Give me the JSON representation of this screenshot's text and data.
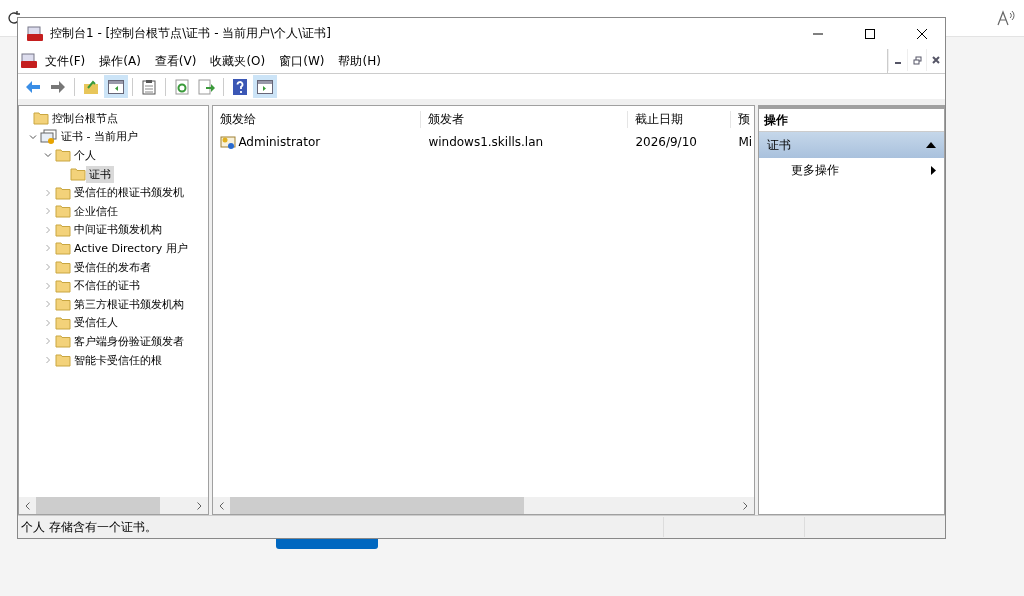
{
  "window": {
    "title": "控制台1 - [控制台根节点\\证书 - 当前用户\\个人\\证书]"
  },
  "menu": [
    "文件(F)",
    "操作(A)",
    "查看(V)",
    "收藏夹(O)",
    "窗口(W)",
    "帮助(H)"
  ],
  "toolbar": [
    {
      "kind": "back",
      "on": false
    },
    {
      "kind": "forward",
      "on": false
    },
    {
      "kind": "up",
      "on": false
    },
    {
      "kind": "tree",
      "on": true
    },
    {
      "kind": "properties",
      "on": false
    },
    {
      "kind": "refresh",
      "on": false
    },
    {
      "kind": "export",
      "on": false
    },
    {
      "kind": "help",
      "on": false
    },
    {
      "kind": "actions",
      "on": true
    }
  ],
  "tree": [
    {
      "label": "控制台根节点",
      "kind": "folder",
      "selected": false,
      "children": [
        {
          "label": "证书 - 当前用户",
          "kind": "store",
          "expanded": true,
          "selected": false,
          "children": [
            {
              "label": "个人",
              "kind": "folder",
              "expanded": true,
              "selected": false,
              "children": [
                {
                  "label": "证书",
                  "kind": "folder",
                  "selected": true
                }
              ]
            },
            {
              "label": "受信任的根证书颁发机",
              "kind": "folder",
              "expanded": false,
              "selected": false
            },
            {
              "label": "企业信任",
              "kind": "folder",
              "expanded": false,
              "selected": false
            },
            {
              "label": "中间证书颁发机构",
              "kind": "folder",
              "expanded": false,
              "selected": false
            },
            {
              "label": "Active Directory 用户",
              "kind": "folder",
              "expanded": false,
              "selected": false
            },
            {
              "label": "受信任的发布者",
              "kind": "folder",
              "expanded": false,
              "selected": false
            },
            {
              "label": "不信任的证书",
              "kind": "folder",
              "expanded": false,
              "selected": false
            },
            {
              "label": "第三方根证书颁发机构",
              "kind": "folder",
              "expanded": false,
              "selected": false
            },
            {
              "label": "受信任人",
              "kind": "folder",
              "expanded": false,
              "selected": false
            },
            {
              "label": "客户端身份验证颁发者",
              "kind": "folder",
              "expanded": false,
              "selected": false
            },
            {
              "label": "智能卡受信任的根",
              "kind": "folder",
              "expanded": false,
              "selected": false
            }
          ]
        }
      ]
    }
  ],
  "table": {
    "columns": [
      "颁发给",
      "颁发者",
      "截止日期",
      "预"
    ],
    "rows": [
      [
        "Administrator",
        "windows1.skills.lan",
        "2026/9/10",
        "Mi"
      ]
    ]
  },
  "actions": {
    "title": "操作",
    "section": {
      "label": "证书",
      "expanded": true
    },
    "items": [
      {
        "label": "更多操作"
      }
    ]
  },
  "status_bar": "个人 存储含有一个证书。"
}
